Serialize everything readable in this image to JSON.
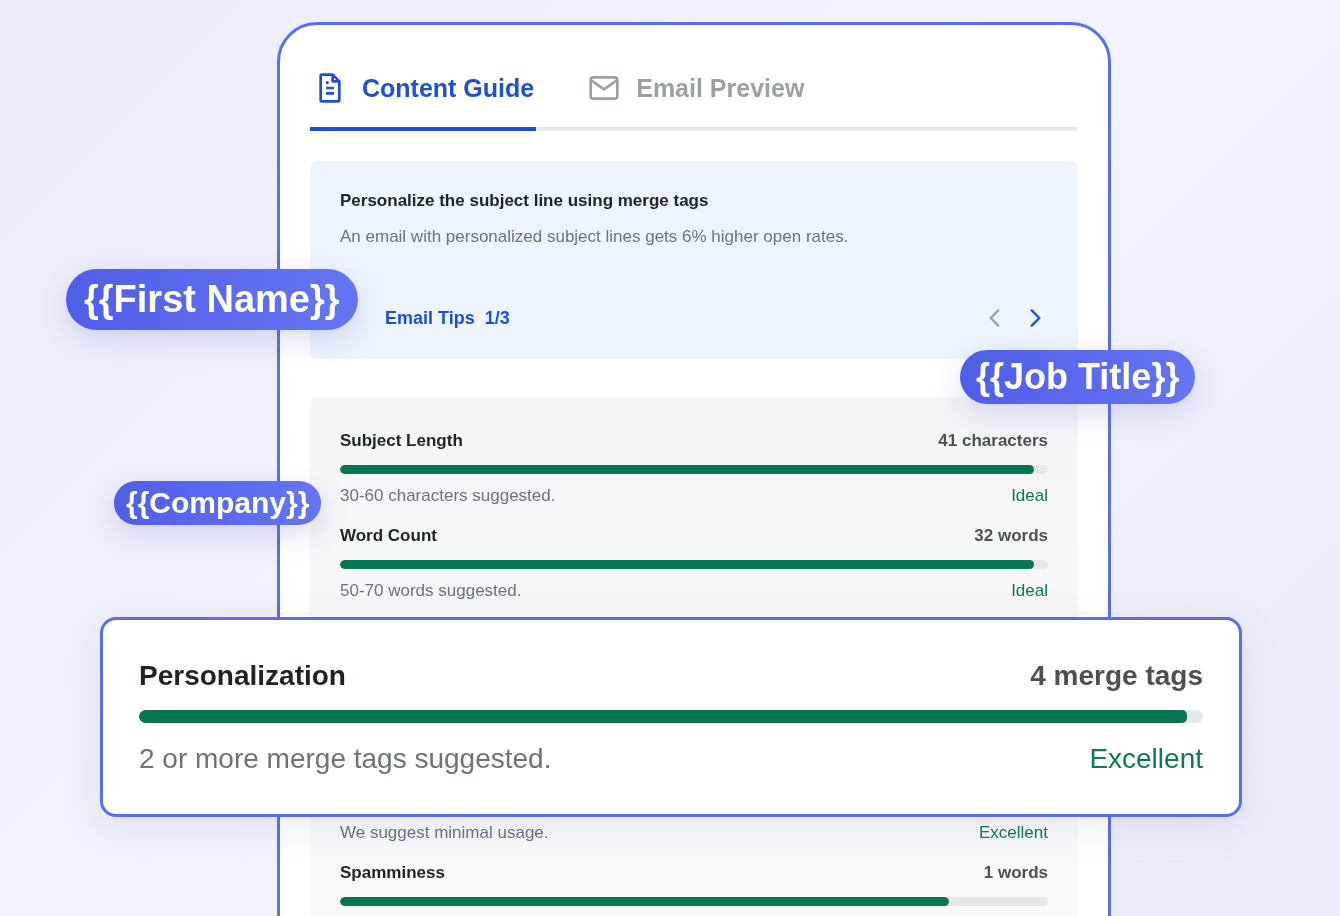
{
  "tabs": [
    {
      "label": "Content Guide",
      "kind": "document",
      "selected": true
    },
    {
      "label": "Email Preview",
      "kind": "mail",
      "selected": false
    }
  ],
  "tip": {
    "title": "Personalize the subject line using merge tags",
    "text": "An email with personalized subject lines gets 6% higher open rates.",
    "link": "Email Tips",
    "page": "1/3",
    "nav": [
      {
        "kind": "prev",
        "disabled": true
      },
      {
        "kind": "next",
        "disabled": false
      }
    ]
  },
  "metrics": [
    {
      "kind": "full",
      "title": "Subject Length",
      "value": "41 characters",
      "level": 0.98,
      "hint": "30-60 characters suggested.",
      "status": "Ideal"
    },
    {
      "kind": "full",
      "title": "Word Count",
      "value": "32 words",
      "level": 0.98,
      "hint": "50-70 words suggested.",
      "status": "Ideal"
    },
    {
      "kind": "partial",
      "hint": "We suggest minimal usage.",
      "status": "Excellent"
    },
    {
      "kind": "top",
      "title": "Spamminess",
      "value": "1 words",
      "level": 0.86
    }
  ],
  "highlight": {
    "title": "Personalization",
    "value": "4 merge tags",
    "level": 0.985,
    "hint": "2 or more merge tags suggested.",
    "status": "Excellent"
  },
  "merge_tags": [
    {
      "label": "{{First Name}}",
      "kind": "large"
    },
    {
      "label": "{{Job Title}}",
      "kind": "medium"
    },
    {
      "label": "{{Company}}",
      "kind": "small"
    }
  ]
}
